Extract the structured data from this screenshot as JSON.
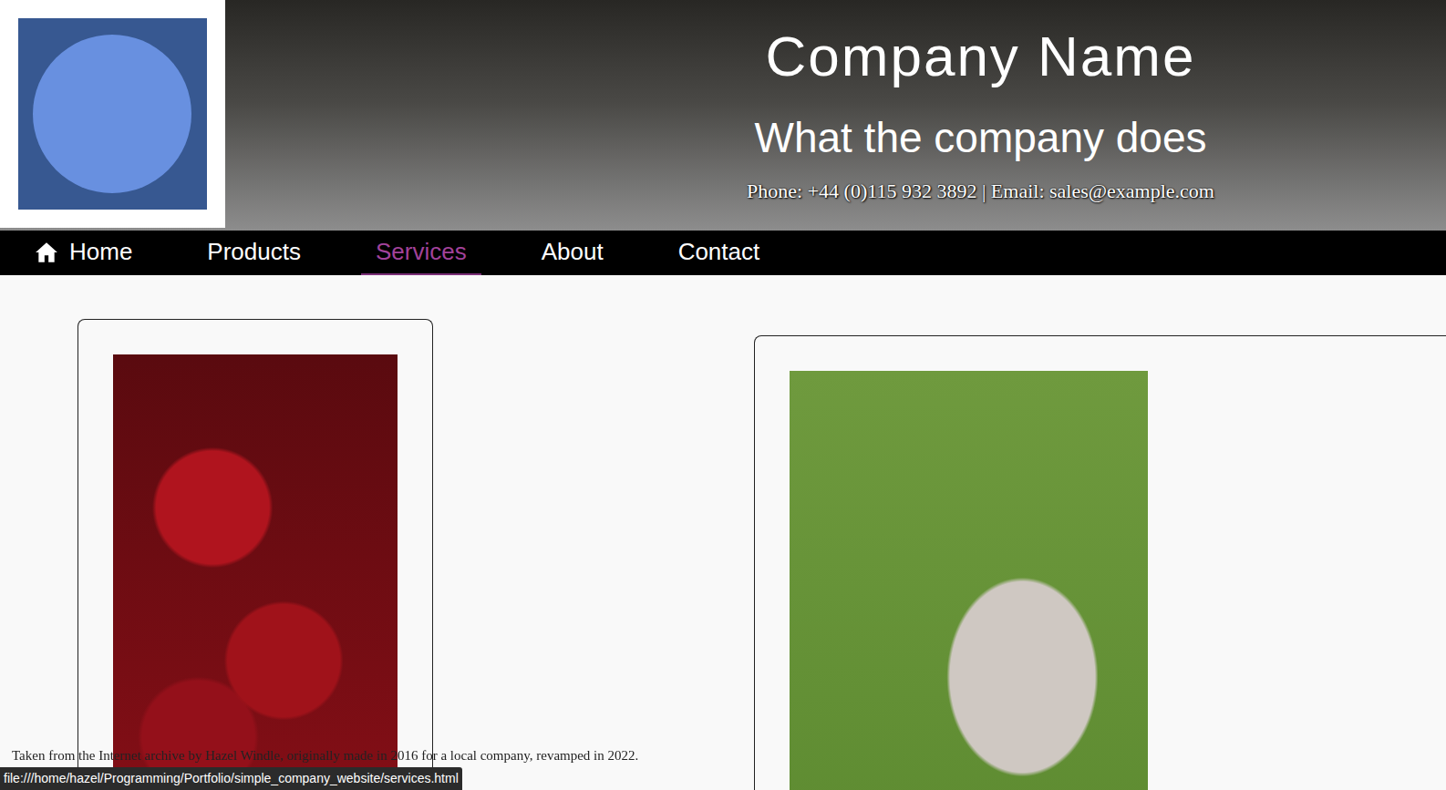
{
  "header": {
    "title": "Company Name",
    "tagline": "What the company does",
    "contact": "Phone: +44 (0)115 932 3892 | Email: sales@example.com"
  },
  "nav": [
    {
      "label": "Home",
      "kind": "home",
      "selected": false
    },
    {
      "label": "Products",
      "kind": "link",
      "selected": false
    },
    {
      "label": "Services",
      "kind": "link",
      "selected": true
    },
    {
      "label": "About",
      "kind": "link",
      "selected": false
    },
    {
      "label": "Contact",
      "kind": "link",
      "selected": false
    }
  ],
  "cards": [
    {
      "kind": "cherries"
    },
    {
      "kind": "swan"
    }
  ],
  "footer": "Taken from the Internet archive by Hazel Windle, originally made in 2016 for a local company, revamped in 2022.",
  "status_bar": "file:///home/hazel/Programming/Portfolio/simple_company_website/services.html"
}
